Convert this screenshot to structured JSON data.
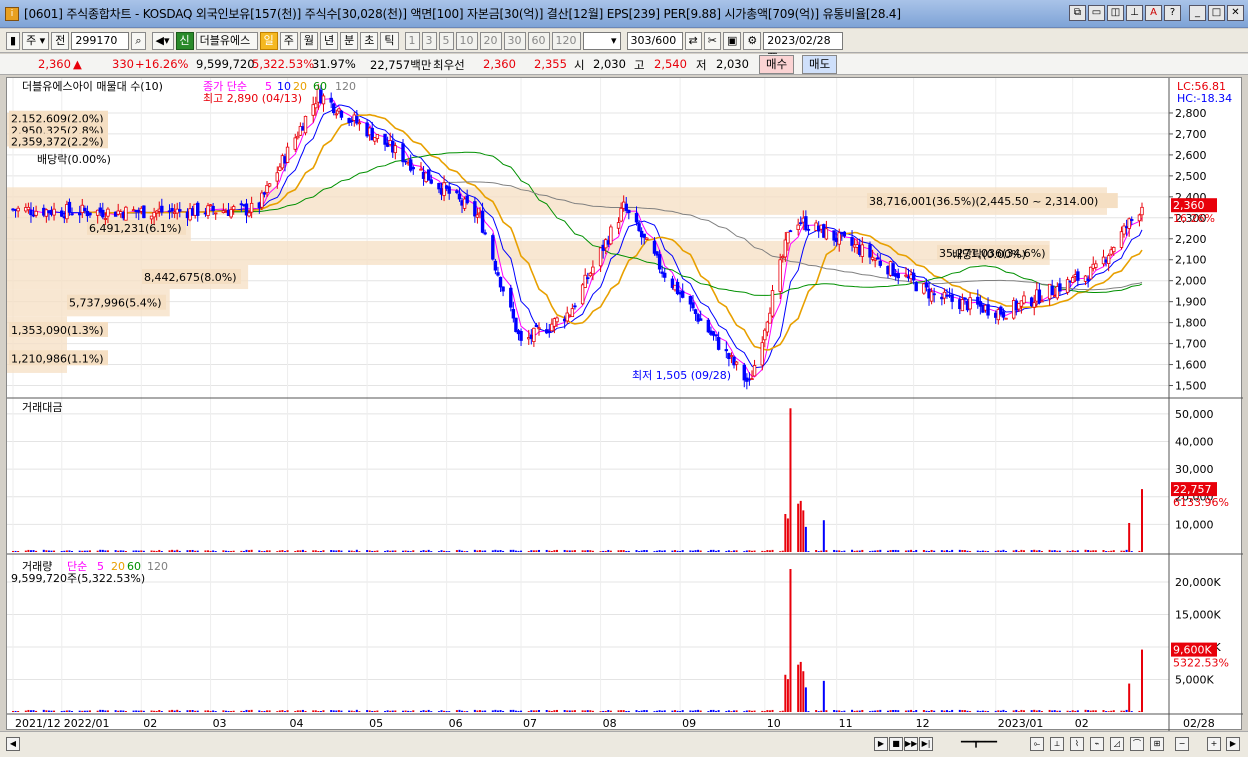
{
  "window": {
    "title": "[0601] 주식종합차트 - KOSDAQ 외국인보유[157(천)] 주식수[30,028(천)] 액면[100] 자본금[30(억)] 결산[12월] EPS[239] PER[9.88] 시가총액[709(억)] 유통비율[28.4]"
  },
  "toolbar": {
    "market": "주",
    "prev": "전",
    "code": "299170",
    "name": "더블유에스",
    "periods": [
      "일",
      "주",
      "월",
      "년",
      "분",
      "초",
      "틱"
    ],
    "ticks": [
      "1",
      "3",
      "5",
      "10",
      "20",
      "30",
      "60",
      "120"
    ],
    "count": "303",
    "count_max": "/600",
    "date": "2023/02/28"
  },
  "quote": {
    "price": "2,360",
    "arrow": "▲",
    "change": "330",
    "rate": "+16.26%",
    "volume": "9,599,720",
    "vol_rate": "5,322.53%",
    "turnover": "31.97%",
    "amount": "22,757백만",
    "bid_label": "최우선",
    "bid1": "2,360",
    "bid2": "2,355",
    "open_label": "시",
    "open": "2,030",
    "high_label": "고",
    "high": "2,540",
    "low_label": "저",
    "low": "2,030",
    "buy": "매수",
    "sell": "매도"
  },
  "price_panel": {
    "title": "더블유에스아이 매물대 수(10)",
    "ma_label": "종가 단순",
    "ma_periods": [
      "5",
      "10",
      "20",
      "60",
      "120"
    ],
    "ma_colors": [
      "#ff00ff",
      "#0000ff",
      "#e8a000",
      "#009000",
      "#808080"
    ],
    "lc": "LC:56.81",
    "hc": "HC:-18.34",
    "high_note": "최고 2,890 (04/13)",
    "low_note": "최저 1,505 (09/28)",
    "cur_price": "2,360",
    "cur_rate": "16.26%",
    "dividend_note1": "배당락(0.00%)",
    "dividend_note2": "배당락(0.00%)",
    "y_ticks": [
      "2,800",
      "2,700",
      "2,600",
      "2,500",
      "2,400",
      "2,300",
      "2,200",
      "2,100",
      "2,000",
      "1,900",
      "1,800",
      "1,700",
      "1,600",
      "1,500"
    ],
    "volume_profile": [
      {
        "label": "2,152,609(2.0%)"
      },
      {
        "label": "2,950,325(2.8%)"
      },
      {
        "label": "2,359,372(2.2%)"
      },
      {
        "label": "38,716,001(36.5%)(2,445.50 ~ 2,314.00)"
      },
      {
        "label": "6,491,231(6.1%)"
      },
      {
        "label": "35,271,036(34.6%)"
      },
      {
        "label": "8,442,675(8.0%)"
      },
      {
        "label": "5,737,996(5.4%)"
      },
      {
        "label": "1,353,090(1.3%)"
      },
      {
        "label": "1,210,986(1.1%)"
      }
    ]
  },
  "amount_panel": {
    "title": "거래대금",
    "cur_value": "22,757",
    "cur_rate": "6133.96%",
    "y_ticks": [
      "50,000",
      "40,000",
      "30,000",
      "20,000",
      "10,000"
    ]
  },
  "volume_panel": {
    "title": "거래량",
    "ma_label": "단순",
    "ma_periods": [
      "5",
      "20",
      "60",
      "120"
    ],
    "note": "9,599,720주(5,322.53%)",
    "cur_value": "9,600K",
    "cur_rate": "5322.53%",
    "y_ticks": [
      "20,000K",
      "15,000K",
      "10,000K",
      "5,000K"
    ]
  },
  "x_axis": {
    "labels": [
      "2021/12",
      "2022/01",
      "02",
      "03",
      "04",
      "05",
      "06",
      "07",
      "08",
      "09",
      "10",
      "11",
      "12",
      "2023/01",
      "02",
      "02/28"
    ]
  },
  "chart_data": {
    "type": "candlestick",
    "x_range": [
      "2021-12-15",
      "2023-02-28"
    ],
    "ylim": [
      1450,
      2900
    ],
    "key_points": [
      {
        "date": "2021-12-15",
        "close": 2340
      },
      {
        "date": "2022-01-10",
        "close": 2330
      },
      {
        "date": "2022-02-15",
        "close": 2330
      },
      {
        "date": "2022-03-20",
        "close": 2340
      },
      {
        "date": "2022-04-13",
        "close": 2890,
        "note": "high"
      },
      {
        "date": "2022-05-15",
        "close": 2600
      },
      {
        "date": "2022-06-15",
        "close": 2300
      },
      {
        "date": "2022-07-01",
        "close": 1700
      },
      {
        "date": "2022-07-20",
        "close": 1850
      },
      {
        "date": "2022-08-10",
        "close": 2350
      },
      {
        "date": "2022-08-25",
        "close": 2050
      },
      {
        "date": "2022-09-28",
        "close": 1505,
        "note": "low"
      },
      {
        "date": "2022-10-15",
        "close": 2300
      },
      {
        "date": "2022-11-10",
        "close": 2150
      },
      {
        "date": "2022-12-10",
        "close": 1920
      },
      {
        "date": "2023-01-05",
        "close": 1850
      },
      {
        "date": "2023-02-10",
        "close": 2050
      },
      {
        "date": "2023-02-28",
        "close": 2360
      }
    ]
  }
}
